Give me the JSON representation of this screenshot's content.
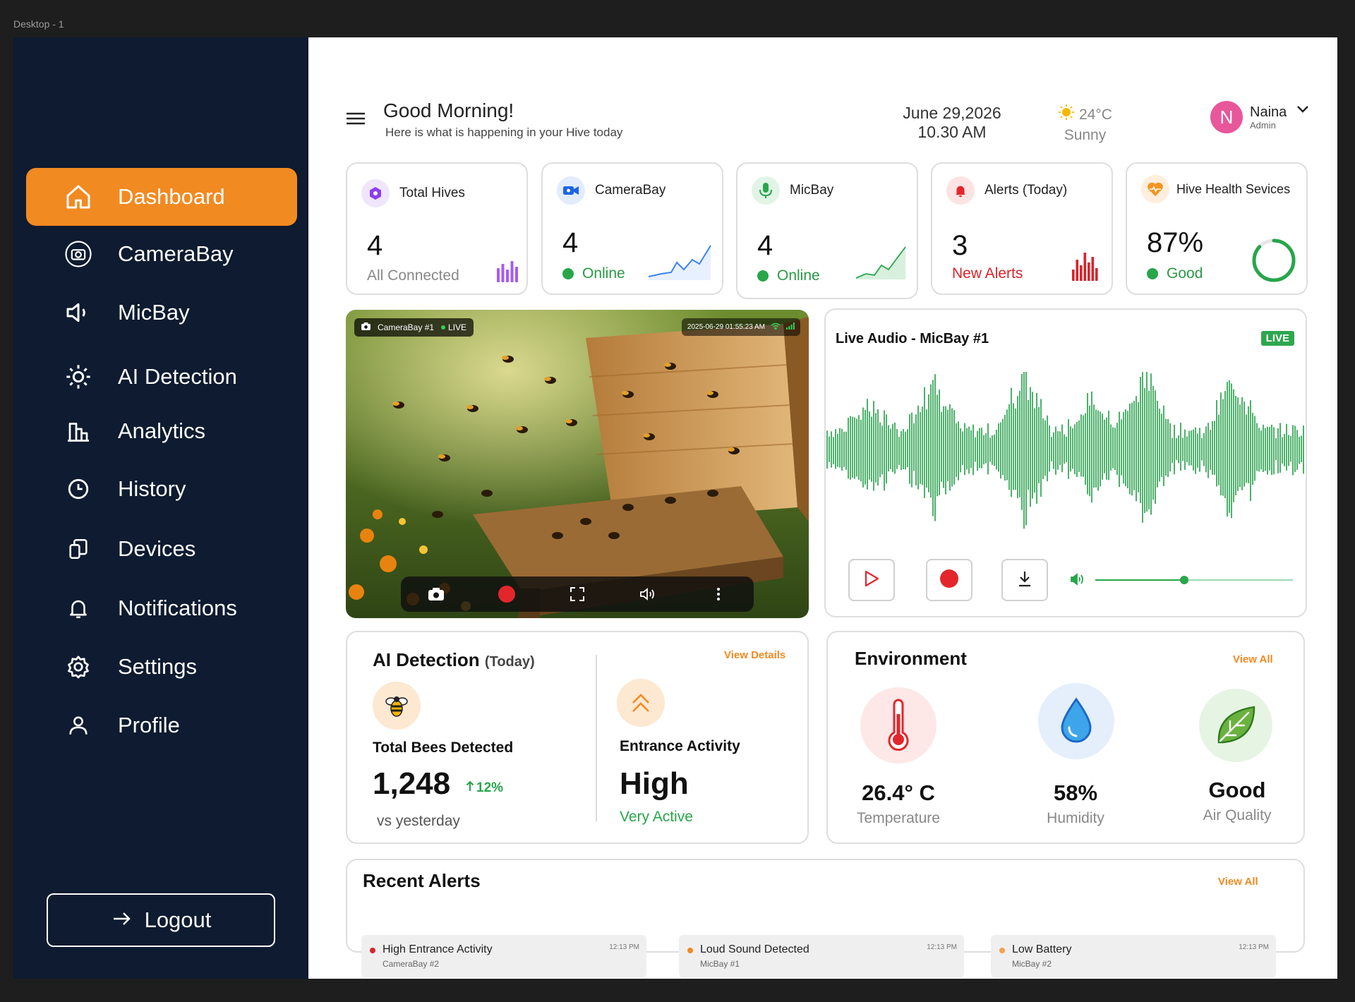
{
  "frame_label": "Desktop - 1",
  "sidebar": {
    "items": [
      {
        "label": "Dashboard",
        "icon": "home-icon"
      },
      {
        "label": "CameraBay",
        "icon": "camera-icon"
      },
      {
        "label": "MicBay",
        "icon": "speaker-icon"
      },
      {
        "label": "AI Detection",
        "icon": "sun-icon"
      },
      {
        "label": "Analytics",
        "icon": "analytics-icon"
      },
      {
        "label": "History",
        "icon": "clock-icon"
      },
      {
        "label": "Devices",
        "icon": "devices-icon"
      },
      {
        "label": "Notifications",
        "icon": "bell-icon"
      },
      {
        "label": "Settings",
        "icon": "gear-icon"
      },
      {
        "label": "Profile",
        "icon": "user-icon"
      }
    ],
    "logout_label": "Logout"
  },
  "header": {
    "greeting": "Good Morning!",
    "subtitle": "Here is what is happening in your Hive today",
    "date": "June 29,2026",
    "time": "10.30 AM",
    "temperature": "24°C",
    "weather": "Sunny",
    "user_initial": "N",
    "user_name": "Naina",
    "user_role": "Admin"
  },
  "stats": {
    "total_hives": {
      "title": "Total Hives",
      "value": "4",
      "sub": "All Connected"
    },
    "camerabay": {
      "title": "CameraBay",
      "value": "4",
      "sub": "Online"
    },
    "micbay": {
      "title": "MicBay",
      "value": "4",
      "sub": "Online"
    },
    "alerts": {
      "title": "Alerts (Today)",
      "value": "3",
      "sub": "New Alerts"
    },
    "health": {
      "title": "Hive Health Sevices",
      "value": "87%",
      "sub": "Good",
      "progress": 0.87
    }
  },
  "camera": {
    "label": "CameraBay #1",
    "live": "LIVE",
    "timestamp": "2025-06-29 01:55:23 AM"
  },
  "audio": {
    "title": "Live Audio  -  MicBay  #1",
    "live": "LIVE",
    "volume": 0.45
  },
  "ai_detection": {
    "title": "AI Detection",
    "period": "(Today)",
    "view_details": "View Details",
    "bees_label": "Total Bees Detected",
    "bees_value": "1,248",
    "change": "12%",
    "compare": "vs yesterday",
    "activity_label": "Entrance Activity",
    "activity_value": "High",
    "activity_sub": "Very Active"
  },
  "environment": {
    "title": "Environment",
    "view_all": "View All",
    "temperature": {
      "value": "26.4° C",
      "label": "Temperature"
    },
    "humidity": {
      "value": "58%",
      "label": "Humidity"
    },
    "air": {
      "value": "Good",
      "label": "Air Quality"
    }
  },
  "recent_alerts": {
    "title": "Recent Alerts",
    "view_all": "View All",
    "items": [
      {
        "title": "High Entrance Activity",
        "source": "CameraBay #2",
        "time": "12:13 PM",
        "color": "#d9232a"
      },
      {
        "title": "Loud Sound Detected",
        "source": "MicBay #1",
        "time": "12:13 PM",
        "color": "#f28a22"
      },
      {
        "title": "Low Battery",
        "source": "MicBay #2",
        "time": "12:13 PM",
        "color": "#f5a14a"
      }
    ]
  },
  "colors": {
    "accent": "#f28a22",
    "sidebar": "#0e1b30",
    "success": "#27a64a",
    "danger": "#d9232a"
  }
}
